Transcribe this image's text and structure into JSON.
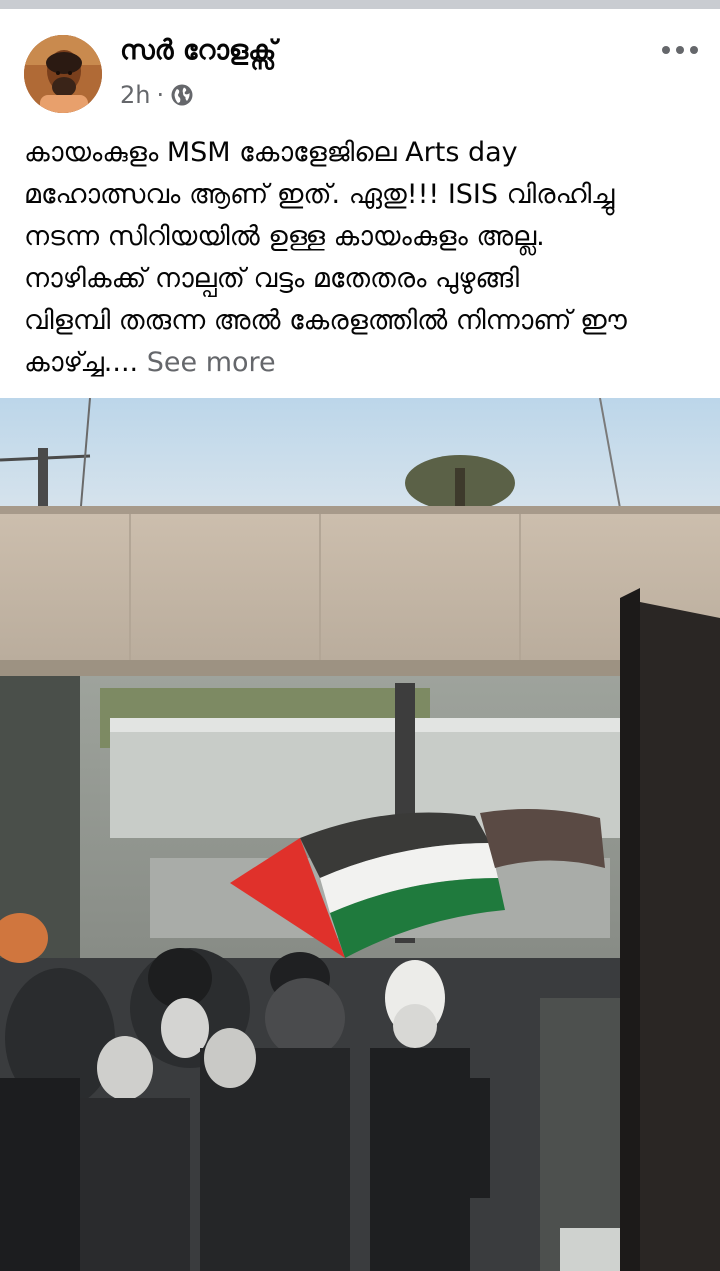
{
  "post": {
    "author": "സർ റോളക്സ്",
    "time": "2h",
    "separator": "·",
    "privacy_icon": "globe-icon",
    "more_icon": "more-horizontal-icon",
    "text_lines": [
      "കായംകുളം MSM കോളേജിലെ Arts day",
      "മഹോത്സവം ആണ് ഇത്. ഏതു!!! ISIS വിരഹിച്ചു",
      "നടന്ന സിറിയയിൽ ഉള്ള കായംകുളം അല്ല.",
      "നാഴികക്ക് നാല്പത് വട്ടം മതേതരം പുഴുങ്ങി",
      "വിളമ്പി തരുന്ന അൽ കേരളത്തിൽ നിന്നാണ് ഈ",
      "കാഴ്ച്ച...."
    ],
    "see_more": "See more"
  },
  "colors": {
    "secondary_text": "#65676b",
    "divider": "#c9ccd1",
    "flag_red": "#e0312b",
    "flag_green": "#1f7a3d"
  }
}
